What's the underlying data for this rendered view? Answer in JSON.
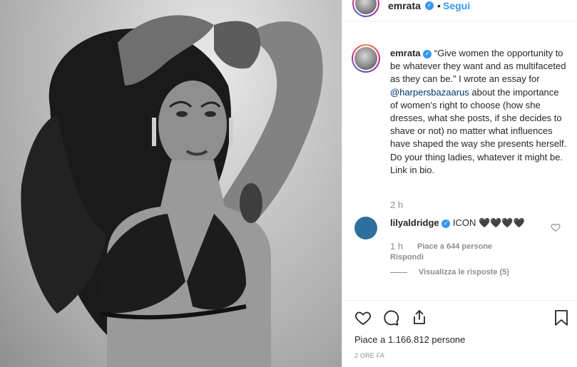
{
  "post": {
    "author": "emrata",
    "follow_label": "Segui",
    "separator": "•",
    "caption_quote": "“Give women the opportunity to be whatever they want and as multifaceted as they can be.” I wrote an essay for ",
    "caption_mention": "@harpersbazaarus",
    "caption_rest": " about the importance of women’s right to choose (how she dresses, what she posts, if she decides to shave or not) no matter what influences have shaped the way she presents herself. Do your thing ladies, whatever it might be. Link in bio.",
    "caption_time": "2 h",
    "likes_label": "Piace a 1.166.812 persone",
    "posted_ago": "2 ORE FA"
  },
  "comment": {
    "author": "lilyaldridge",
    "text": "ICON 🖤🖤🖤🖤",
    "time": "1 h",
    "likes": "Piace a 644 persone",
    "reply": "Rispondi",
    "view_replies": "Visualizza le risposte (5)"
  },
  "icons": {
    "verified": "verified-badge-icon",
    "like": "heart-icon",
    "comment": "comment-bubble-icon",
    "share": "share-icon",
    "save": "bookmark-icon"
  },
  "colors": {
    "link": "#3897f0",
    "mention": "#003569",
    "muted": "#8e8e8e",
    "text": "#262626"
  }
}
